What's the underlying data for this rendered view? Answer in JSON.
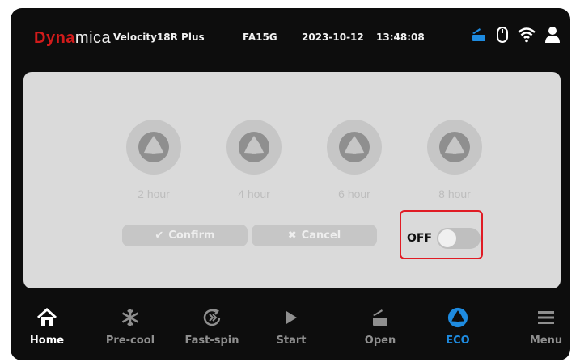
{
  "header": {
    "brand_part1": "Dyna",
    "brand_part2": "mica",
    "model": "Velocity18R Plus",
    "code": "FA15G",
    "date": "2023-10-12",
    "time": "13:48:08",
    "icons": [
      "door-open-icon",
      "mouse-icon",
      "wifi-icon",
      "user-icon"
    ]
  },
  "timers": [
    {
      "label": "2 hour",
      "icon": "eco-icon"
    },
    {
      "label": "4 hour",
      "icon": "eco-icon"
    },
    {
      "label": "6 hour",
      "icon": "eco-icon"
    },
    {
      "label": "8 hour",
      "icon": "eco-icon"
    }
  ],
  "actions": {
    "confirm_label": "Confirm",
    "cancel_label": "Cancel"
  },
  "toggle": {
    "label": "OFF",
    "state": false
  },
  "navbar": [
    {
      "label": "Home",
      "icon": "home-icon",
      "state": "active"
    },
    {
      "label": "Pre-cool",
      "icon": "snowflake-icon",
      "state": "disabled"
    },
    {
      "label": "Fast-spin",
      "icon": "fast-spin-icon",
      "state": "disabled"
    },
    {
      "label": "Start",
      "icon": "play-icon",
      "state": "disabled"
    },
    {
      "label": "Open",
      "icon": "lid-open-icon",
      "state": "disabled"
    },
    {
      "label": "ECO",
      "icon": "eco-icon",
      "state": "selected"
    },
    {
      "label": "Menu",
      "icon": "menu-icon",
      "state": "disabled"
    }
  ],
  "colors": {
    "background": "#0d0d0d",
    "panel": "#dadada",
    "accent_blue": "#1e8be0",
    "brand_red": "#d21b1b",
    "highlight_red": "#e01b24",
    "disabled": "#8f8f8f"
  }
}
